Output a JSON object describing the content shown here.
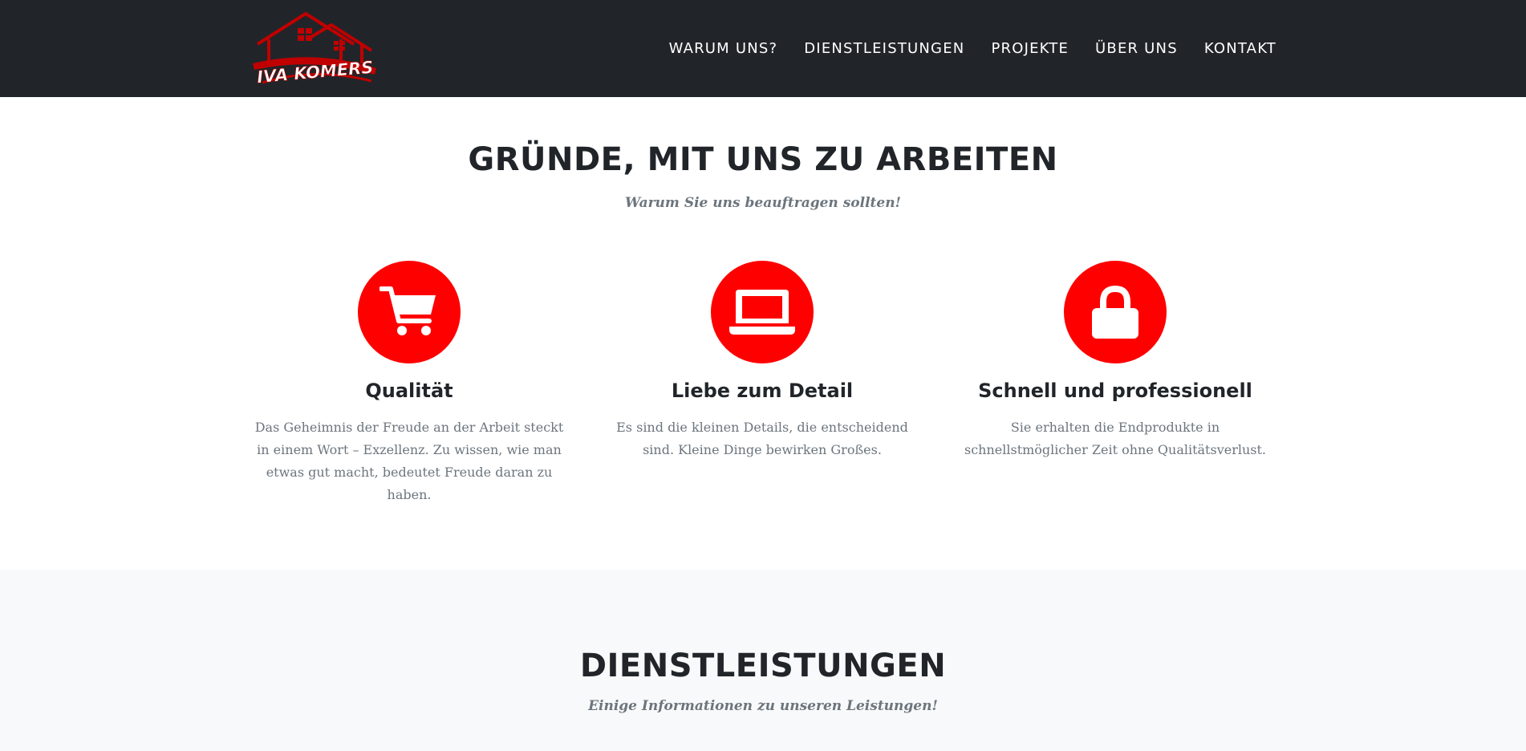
{
  "brand": {
    "name": "Iva Komers",
    "logo_text": "IVA KOMERS",
    "colors": {
      "red": "#ff0000",
      "dark": "#212529"
    }
  },
  "nav": {
    "items": [
      {
        "label": "WARUM UNS?"
      },
      {
        "label": "DIENSTLEISTUNGEN"
      },
      {
        "label": "PROJEKTE"
      },
      {
        "label": "ÜBER UNS"
      },
      {
        "label": "KONTAKT"
      }
    ]
  },
  "features_section": {
    "heading": "GRÜNDE, MIT UNS ZU ARBEITEN",
    "subheading": "Warum Sie uns beauftragen sollten!",
    "items": [
      {
        "icon": "shopping-cart-icon",
        "title": "Qualität",
        "text": "Das Geheimnis der Freude an der Arbeit steckt in einem Wort – Exzellenz. Zu wissen, wie man etwas gut macht, bedeutet Freude daran zu haben."
      },
      {
        "icon": "laptop-icon",
        "title": "Liebe zum Detail",
        "text": "Es sind die kleinen Details, die entscheidend sind. Kleine Dinge bewirken Großes."
      },
      {
        "icon": "lock-icon",
        "title": "Schnell und professionell",
        "text": "Sie erhalten die Endprodukte in schnellstmöglicher Zeit ohne Qualitätsverlust."
      }
    ]
  },
  "services_section": {
    "heading": "DIENSTLEISTUNGEN",
    "subheading": "Einige Informationen zu unseren Leistungen!"
  }
}
